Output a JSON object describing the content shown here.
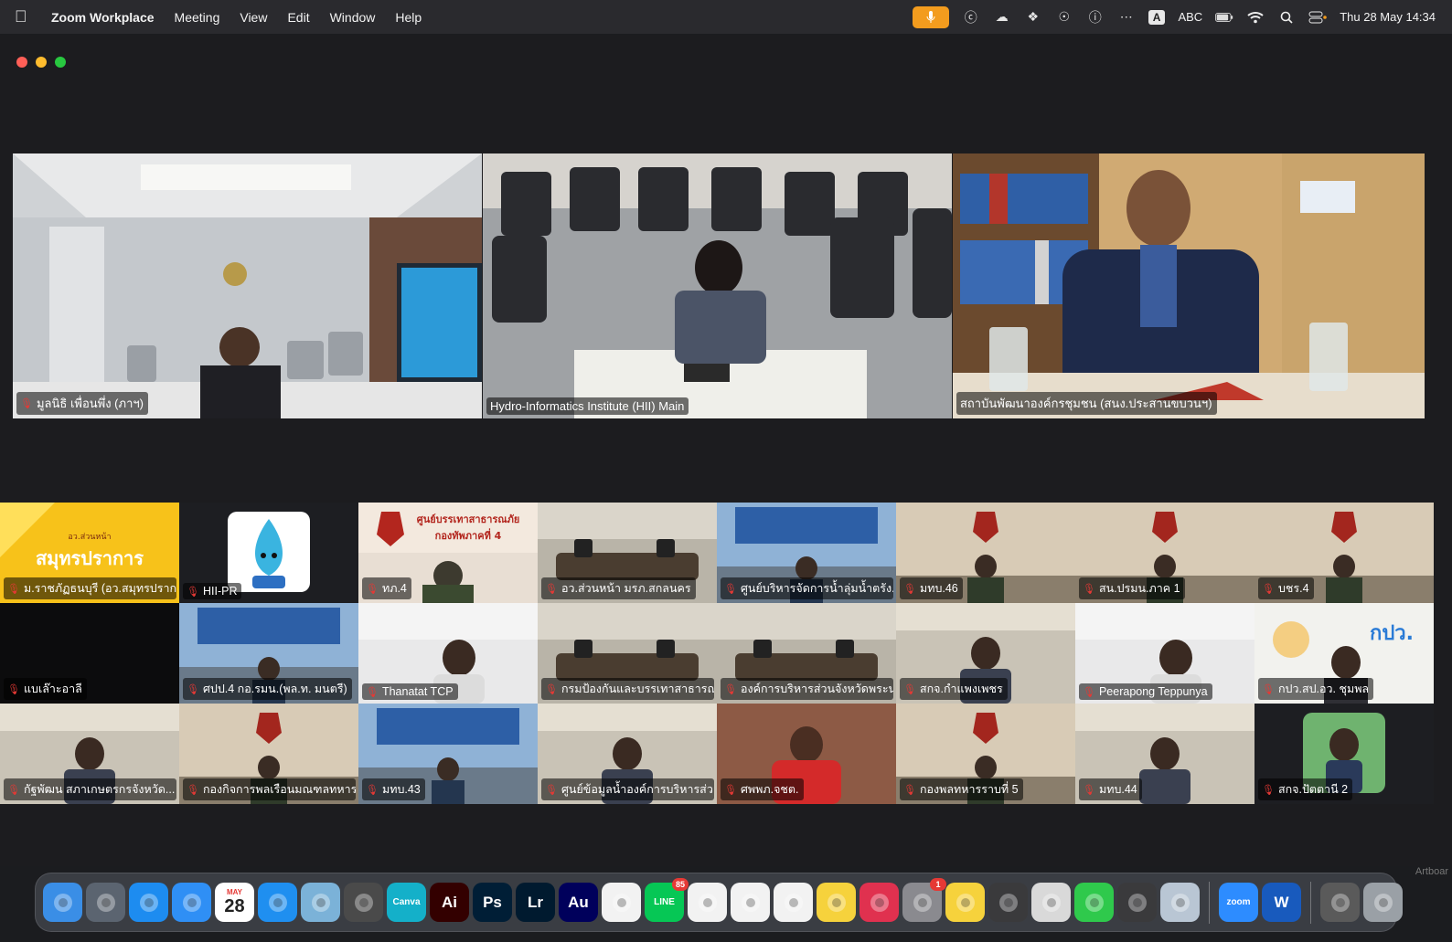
{
  "menubar": {
    "app_name": "Zoom Workplace",
    "menus": [
      "Meeting",
      "View",
      "Edit",
      "Window",
      "Help"
    ],
    "input_source": "ABC",
    "input_letter": "A",
    "datetime": "Thu 28 May  14:34"
  },
  "speakers": [
    {
      "name": "มูลนิธิ เพื่อนพึ่ง (ภาฯ)",
      "muted": true,
      "scene": "office-room"
    },
    {
      "name": "Hydro-Informatics Institute (HII) Main",
      "muted": false,
      "scene": "meeting-chairs"
    },
    {
      "name": "สถาบันพัฒนาองค์กรชุมชน (สนง.ประสานขบวนฯ)",
      "muted": false,
      "scene": "bookshelf",
      "active": true
    }
  ],
  "gallery": [
    {
      "name": "ม.ราชภัฏธนบุรี (อว.สมุทรปราก...",
      "muted": true,
      "scene": "banner",
      "banner_text": "สมุทรปราการ",
      "banner_sub": "อว.ส่วนหน้า"
    },
    {
      "name": "HII-PR",
      "muted": true,
      "scene": "mascot"
    },
    {
      "name": "ทภ.4",
      "muted": true,
      "scene": "army-banner",
      "banner_text": "ศูนย์บรรเทาสาธารณภัย",
      "banner_sub": "กองทัพภาคที่ 4"
    },
    {
      "name": "อว.ส่วนหน้า มรภ.สกลนคร",
      "muted": true,
      "scene": "room"
    },
    {
      "name": "ศูนย์บริหารจัดการน้ำลุ่มน้ำตรัง...",
      "muted": true,
      "scene": "blue-room"
    },
    {
      "name": "มทบ.46",
      "muted": true,
      "scene": "army-room"
    },
    {
      "name": "สน.ปรมน.ภาค 1",
      "muted": true,
      "scene": "army-room"
    },
    {
      "name": "บชร.4",
      "muted": true,
      "scene": "army-room"
    },
    {
      "name": "แบเล๊าะอาลี",
      "muted": true,
      "scene": "black"
    },
    {
      "name": "ศปป.4 กอ.รมน.(พล.ท. มนตรี)",
      "muted": true,
      "scene": "blue-room"
    },
    {
      "name": "Thanatat TCP",
      "muted": true,
      "scene": "person-light"
    },
    {
      "name": "กรมป้องกันและบรรเทาสาธารณ...",
      "muted": true,
      "scene": "room"
    },
    {
      "name": "องค์การบริหารส่วนจังหวัดพระน...",
      "muted": true,
      "scene": "room"
    },
    {
      "name": "สกจ.กำแพงเพชร",
      "muted": true,
      "scene": "person-room"
    },
    {
      "name": "Peerapong Teppunya",
      "muted": true,
      "scene": "person-light"
    },
    {
      "name": "กปว.สป.อว. ชุมพล",
      "muted": true,
      "scene": "poster",
      "banner_text": "กปว."
    },
    {
      "name": "กัฐพัฒน สภาเกษตรกรจังหวัด...",
      "muted": true,
      "scene": "person-room"
    },
    {
      "name": "กองกิจการพลเรือนมณฑลทหาร...",
      "muted": true,
      "scene": "army-room"
    },
    {
      "name": "มทบ.43",
      "muted": true,
      "scene": "blue-room"
    },
    {
      "name": "ศูนย์ข้อมูลน้ำองค์การบริหารส่ว...",
      "muted": true,
      "scene": "person-room"
    },
    {
      "name": "ศพพภ.จชต.",
      "muted": true,
      "scene": "red-curtain"
    },
    {
      "name": "กองพลทหารราบที่ 5",
      "muted": true,
      "scene": "army-room"
    },
    {
      "name": "มทบ.44",
      "muted": true,
      "scene": "person-room"
    },
    {
      "name": "สกจ.ปัตตานี 2",
      "muted": true,
      "scene": "avatar"
    }
  ],
  "dock": [
    {
      "name": "Finder",
      "icon": "finder-icon",
      "label": "",
      "color": "#3a8ee6"
    },
    {
      "name": "Launchpad",
      "icon": "launchpad-icon",
      "label": "",
      "color": "#5b6470"
    },
    {
      "name": "Safari",
      "icon": "safari-icon",
      "label": "",
      "color": "#1d8cf0"
    },
    {
      "name": "Mail",
      "icon": "mail-icon",
      "label": "",
      "color": "#2f8ff5"
    },
    {
      "name": "Calendar",
      "icon": "calendar-icon",
      "label": "28",
      "sub": "MAY",
      "color": "#ffffff"
    },
    {
      "name": "App Store",
      "icon": "appstore-icon",
      "label": "",
      "color": "#1f8ff0"
    },
    {
      "name": "Preview",
      "icon": "preview-icon",
      "label": "",
      "color": "#7bb2d8"
    },
    {
      "name": "Calculator",
      "icon": "calculator-icon",
      "label": "",
      "color": "#4a4a4a"
    },
    {
      "name": "Canva",
      "icon": "canva-icon",
      "label": "Canva",
      "color": "#14b0c9"
    },
    {
      "name": "Illustrator",
      "icon": "illustrator-icon",
      "label": "Ai",
      "color": "#330000"
    },
    {
      "name": "Photoshop",
      "icon": "photoshop-icon",
      "label": "Ps",
      "color": "#001e36"
    },
    {
      "name": "Lightroom",
      "icon": "lightroom-icon",
      "label": "Lr",
      "color": "#001a2f"
    },
    {
      "name": "Audition",
      "icon": "audition-icon",
      "label": "Au",
      "color": "#00005b"
    },
    {
      "name": "Photos",
      "icon": "photos-icon",
      "label": "",
      "color": "#f2f2f2"
    },
    {
      "name": "LINE",
      "icon": "line-icon",
      "label": "LINE",
      "badge": "85",
      "color": "#06c755"
    },
    {
      "name": "Music",
      "icon": "music-icon",
      "label": "",
      "color": "#f2f2f2"
    },
    {
      "name": "Chrome",
      "icon": "chrome-icon",
      "label": "",
      "color": "#f2f2f2"
    },
    {
      "name": "Reminders",
      "icon": "reminders-icon",
      "label": "",
      "color": "#f2f2f2"
    },
    {
      "name": "Notes",
      "icon": "notes-icon",
      "label": "",
      "color": "#f6d23c"
    },
    {
      "name": "Creative Cloud",
      "icon": "creative-cloud-icon",
      "label": "",
      "color": "#e0314f"
    },
    {
      "name": "System Settings",
      "icon": "settings-icon",
      "label": "",
      "badge": "1",
      "color": "#8a8a8f"
    },
    {
      "name": "Stickies",
      "icon": "stickies-icon",
      "label": "",
      "color": "#f6d23c"
    },
    {
      "name": "QuickTime",
      "icon": "quicktime-icon",
      "label": "",
      "color": "#3a3a3c"
    },
    {
      "name": "Script Editor",
      "icon": "script-icon",
      "label": "",
      "color": "#d9d9d9"
    },
    {
      "name": "FaceTime",
      "icon": "facetime-icon",
      "label": "",
      "color": "#2fc94c"
    },
    {
      "name": "Screenshot",
      "icon": "screenshot-icon",
      "label": "",
      "color": "#3a3a3c"
    },
    {
      "name": "Image Capture",
      "icon": "image-capture-icon",
      "label": "",
      "color": "#b9c6d4"
    },
    {
      "name": "Zoom",
      "icon": "zoom-icon",
      "label": "zoom",
      "color": "#2d8cff"
    },
    {
      "name": "Word",
      "icon": "word-icon",
      "label": "W",
      "color": "#185abd"
    },
    {
      "name": "Scanner",
      "icon": "scanner-icon",
      "label": "",
      "color": "#5a5a5a"
    },
    {
      "name": "Trash",
      "icon": "trash-icon",
      "label": "",
      "color": "#9aa0a6"
    }
  ],
  "edge_label": "Artboar"
}
